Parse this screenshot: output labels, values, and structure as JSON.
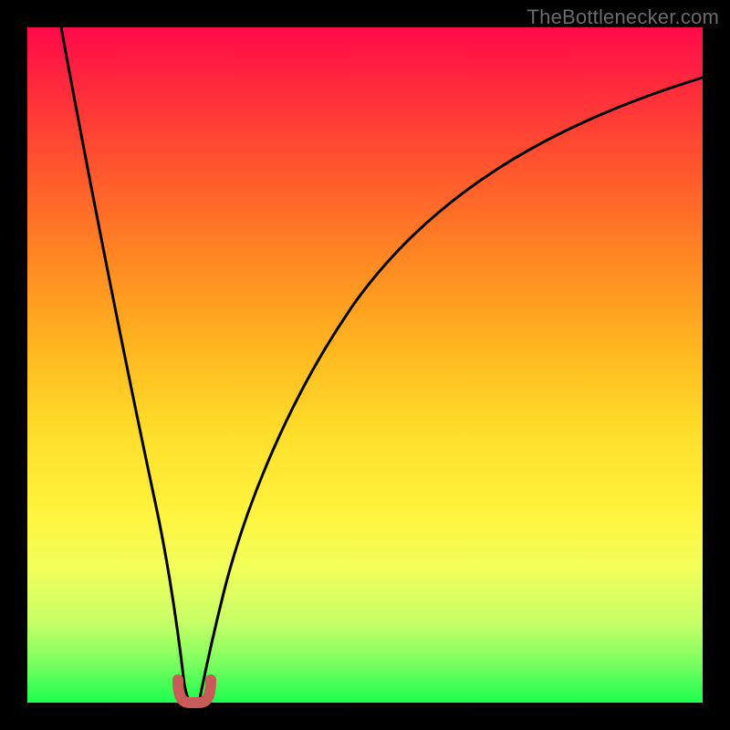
{
  "watermark": "TheBottlenecker.com",
  "colors": {
    "frame": "#000000",
    "curve": "#000000",
    "marker": "#c85a57",
    "gradient_top": "#ff0a4a",
    "gradient_bottom": "#1aff4e"
  },
  "chart_data": {
    "type": "line",
    "title": "",
    "xlabel": "",
    "ylabel": "",
    "xlim": [
      0,
      100
    ],
    "ylim": [
      0,
      100
    ],
    "series": [
      {
        "name": "left-branch",
        "x": [
          5,
          8,
          12,
          15,
          18,
          20,
          21,
          22,
          23
        ],
        "values": [
          100,
          80,
          55,
          36,
          18,
          8,
          4,
          1,
          0
        ]
      },
      {
        "name": "right-branch",
        "x": [
          25,
          26,
          28,
          31,
          35,
          40,
          46,
          54,
          63,
          73,
          84,
          95,
          100
        ],
        "values": [
          0,
          3,
          10,
          20,
          32,
          43,
          53,
          63,
          72,
          80,
          86,
          91,
          93
        ]
      },
      {
        "name": "optimum-marker",
        "x": [
          22,
          22.5,
          23,
          24,
          24.5,
          25
        ],
        "values": [
          3,
          1,
          0,
          0,
          1,
          3
        ]
      }
    ],
    "annotations": [
      {
        "text": "TheBottlenecker.com",
        "pos": "top-right"
      }
    ]
  }
}
